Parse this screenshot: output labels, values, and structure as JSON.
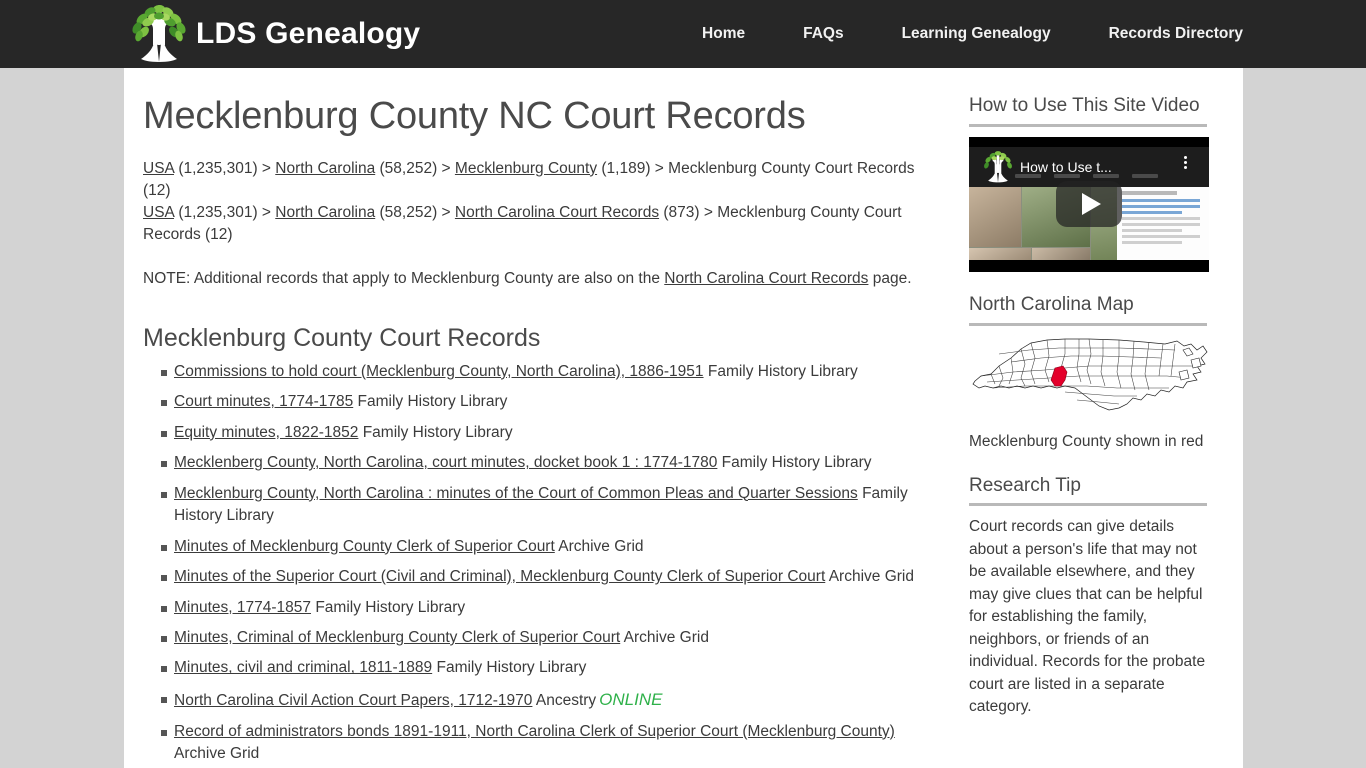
{
  "header": {
    "brand_name": "LDS Genealogy",
    "logo_icon": "family-tree-icon",
    "nav": [
      {
        "label": "Home"
      },
      {
        "label": "FAQs"
      },
      {
        "label": "Learning Genealogy"
      },
      {
        "label": "Records Directory"
      }
    ]
  },
  "main": {
    "page_title": "Mecklenburg County NC Court Records",
    "breadcrumbs": [
      {
        "parts": [
          {
            "text": "USA",
            "link": true
          },
          {
            "text": " (1,235,301) > ",
            "link": false
          },
          {
            "text": "North Carolina",
            "link": true
          },
          {
            "text": " (58,252) > ",
            "link": false
          },
          {
            "text": "Mecklenburg County",
            "link": true
          },
          {
            "text": " (1,189) > Mecklenburg County Court Records (12)",
            "link": false
          }
        ]
      },
      {
        "parts": [
          {
            "text": "USA",
            "link": true
          },
          {
            "text": " (1,235,301) > ",
            "link": false
          },
          {
            "text": "North Carolina",
            "link": true
          },
          {
            "text": " (58,252) > ",
            "link": false
          },
          {
            "text": "North Carolina Court Records",
            "link": true
          },
          {
            "text": " (873) > Mecklenburg County Court Records (12)",
            "link": false
          }
        ]
      }
    ],
    "note": {
      "before": "NOTE: Additional records that apply to Mecklenburg County are also on the ",
      "link": "North Carolina Court Records",
      "after": " page."
    },
    "section_title": "Mecklenburg County Court Records",
    "records": [
      {
        "title": "Commissions to hold court (Mecklenburg County, North Carolina), 1886-1951",
        "repository": "Family History Library",
        "online": ""
      },
      {
        "title": "Court minutes, 1774-1785",
        "repository": "Family History Library",
        "online": ""
      },
      {
        "title": "Equity minutes, 1822-1852",
        "repository": "Family History Library",
        "online": ""
      },
      {
        "title": "Mecklenberg County, North Carolina, court minutes, docket book 1 : 1774-1780",
        "repository": "Family History Library",
        "online": ""
      },
      {
        "title": "Mecklenburg County, North Carolina : minutes of the Court of Common Pleas and Quarter Sessions",
        "repository": "Family History Library",
        "online": ""
      },
      {
        "title": "Minutes of Mecklenburg County Clerk of Superior Court",
        "repository": "Archive Grid",
        "online": ""
      },
      {
        "title": "Minutes of the Superior Court (Civil and Criminal), Mecklenburg County Clerk of Superior Court",
        "repository": "Archive Grid",
        "online": ""
      },
      {
        "title": "Minutes, 1774-1857",
        "repository": "Family History Library",
        "online": ""
      },
      {
        "title": "Minutes, Criminal of Mecklenburg County Clerk of Superior Court",
        "repository": "Archive Grid",
        "online": ""
      },
      {
        "title": "Minutes, civil and criminal, 1811-1889",
        "repository": "Family History Library",
        "online": ""
      },
      {
        "title": "North Carolina Civil Action Court Papers, 1712-1970",
        "repository": "Ancestry",
        "online": "ONLINE"
      },
      {
        "title": "Record of administrators bonds 1891-1911, North Carolina Clerk of Superior Court (Mecklenburg County)",
        "repository": "Archive Grid",
        "online": ""
      }
    ]
  },
  "sidebar": {
    "video_block": {
      "heading": "How to Use This Site Video",
      "thumbnail_title": "How to Use t...",
      "play_icon": "play-button-icon",
      "menu_icon": "kebab-menu-icon"
    },
    "map_block": {
      "heading": "North Carolina Map",
      "map_icon": "north-carolina-county-map",
      "caption": "Mecklenburg County shown in red",
      "highlight_color": "#e4002b"
    },
    "tip_block": {
      "heading": "Research Tip",
      "text": "Court records can give details about a person's life that may not be available elsewhere, and they may give clues that can be helpful for establishing the family, neighbors, or friends of an individual.  Records for the probate court are listed in a separate category."
    }
  },
  "colors": {
    "header_bg": "#272727",
    "page_bg": "#d3d3d3",
    "card_bg": "#ffffff",
    "text": "#3b3b3b",
    "heading": "#4a4a4a",
    "online_green": "#2fb14a",
    "rule": "#b9b9b9"
  }
}
